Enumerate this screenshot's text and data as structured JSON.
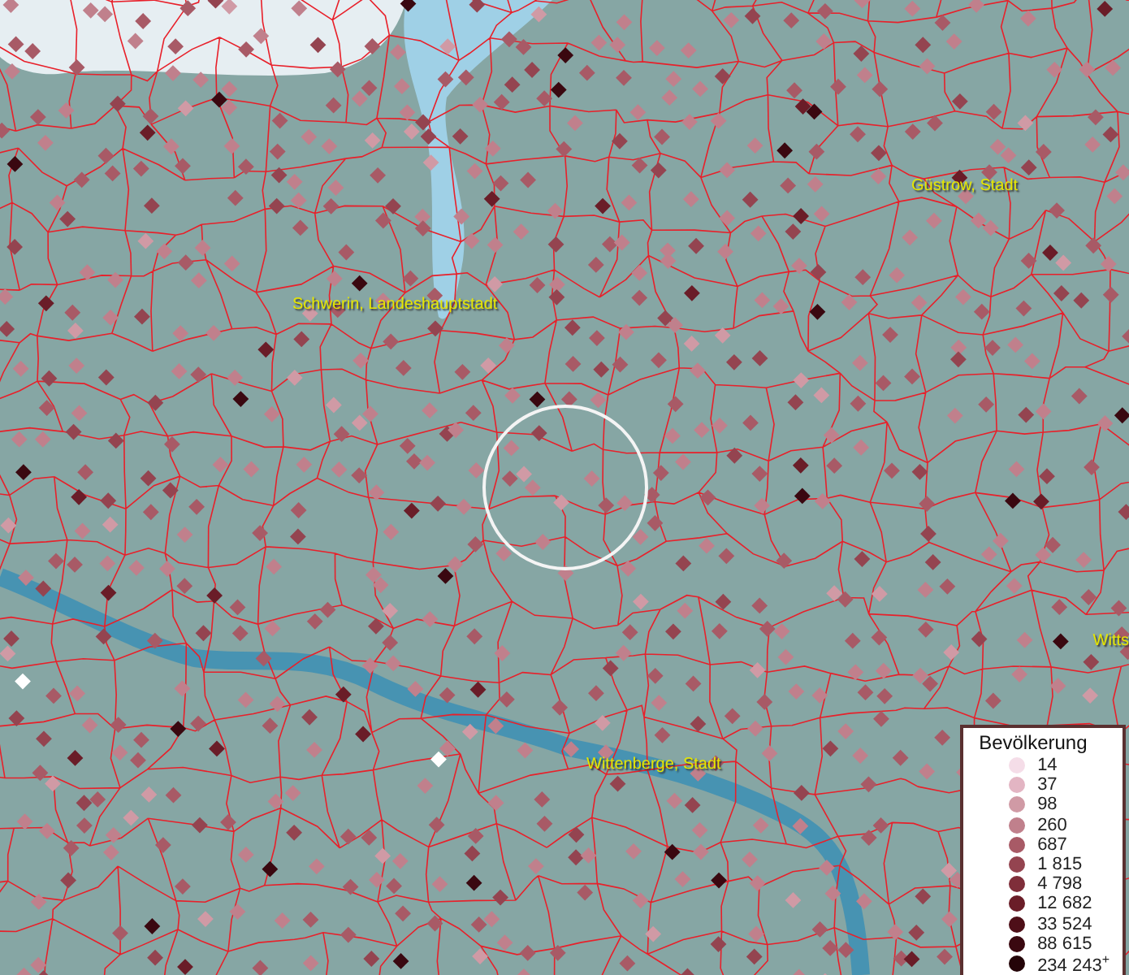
{
  "map": {
    "places": [
      {
        "name": "Schwerin, Landeshauptstadt"
      },
      {
        "name": "Güstrow, Stadt"
      },
      {
        "name": "Wittenberge, Stadt"
      },
      {
        "name": "Witts"
      }
    ]
  },
  "legend": {
    "title": "Bevölkerung",
    "entries": [
      {
        "label": "14",
        "color": "#f5dde8"
      },
      {
        "label": "37",
        "color": "#e3b5c3"
      },
      {
        "label": "98",
        "color": "#d09aa5"
      },
      {
        "label": "260",
        "color": "#c0808c"
      },
      {
        "label": "687",
        "color": "#a85a66"
      },
      {
        "label": "1 815",
        "color": "#944450"
      },
      {
        "label": "4 798",
        "color": "#7f2e3a"
      },
      {
        "label": "12 682",
        "color": "#6a1d28"
      },
      {
        "label": "33 524",
        "color": "#4e0f18"
      },
      {
        "label": "88 615",
        "color": "#3a0810"
      },
      {
        "label": "234 243$^{+}$",
        "color": "#240408"
      }
    ]
  }
}
